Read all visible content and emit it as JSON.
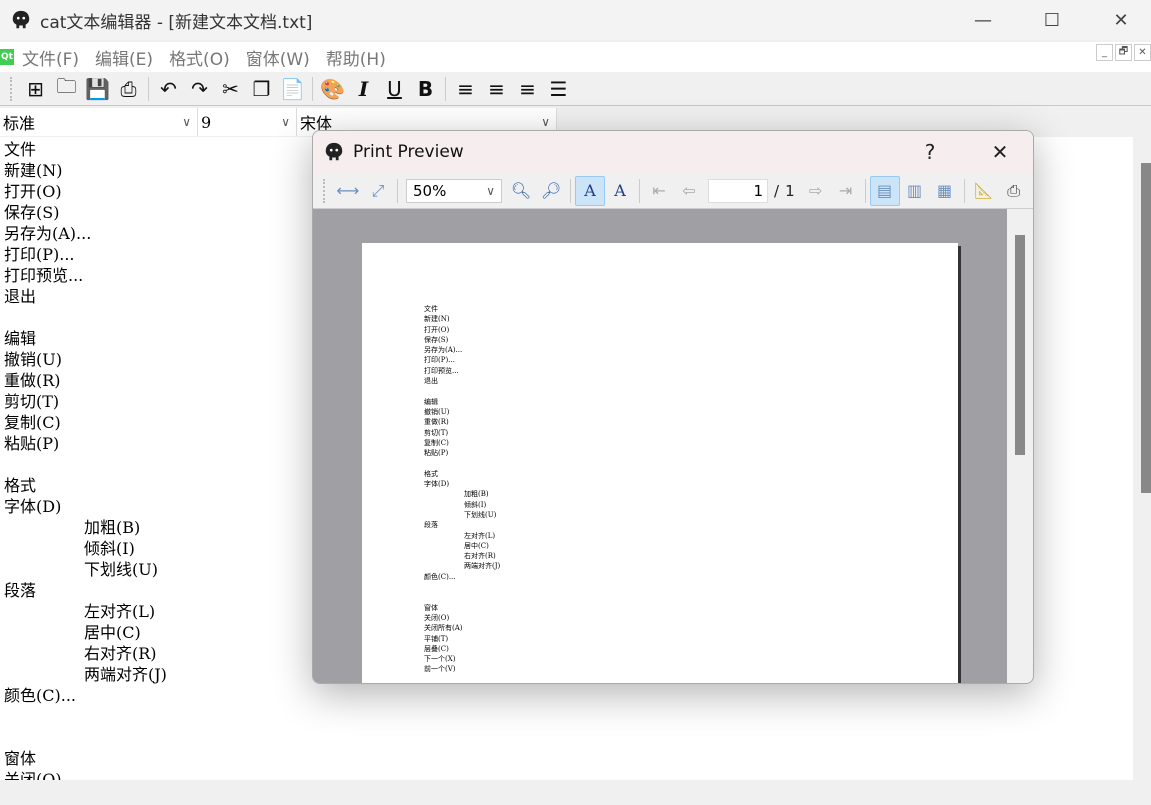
{
  "window": {
    "title": "cat文本编辑器 - [新建文本文档.txt]",
    "minimize": "—",
    "maximize": "☐",
    "close": "✕"
  },
  "menubar": {
    "logo": "Qt",
    "items": [
      "文件(F)",
      "编辑(E)",
      "格式(O)",
      "窗体(W)",
      "帮助(H)"
    ],
    "mdi": [
      "_",
      "🗗",
      "✕"
    ]
  },
  "toolbar": {
    "icons": [
      "new-file-icon",
      "open-folder-icon",
      "save-icon",
      "print-icon",
      "undo-icon",
      "redo-icon",
      "cut-icon",
      "copy-icon",
      "paste-icon",
      "color-palette-icon",
      "italic-icon",
      "underline-icon",
      "bold-icon",
      "align-left-icon",
      "align-center-icon",
      "align-right-icon",
      "justify-icon"
    ],
    "glyphs": [
      "⊞",
      "🗀",
      "💾",
      "⎙",
      "↶",
      "↷",
      "✂",
      "❐",
      "📄",
      "🎨",
      "I",
      "U",
      "B",
      "≡",
      "≡",
      "≡",
      "☰"
    ]
  },
  "combos": {
    "style": "标准",
    "size": "9",
    "font": "宋体"
  },
  "document": {
    "lines": [
      "文件",
      "新建(N)",
      "打开(O)",
      "保存(S)",
      "另存为(A)...",
      "打印(P)...",
      "打印预览...",
      "退出",
      "",
      "编辑",
      "撤销(U)",
      "重做(R)",
      "剪切(T)",
      "复制(C)",
      "粘贴(P)",
      "",
      "格式",
      "字体(D)",
      "\t加粗(B)",
      "\t倾斜(I)",
      "\t下划线(U)",
      "段落",
      "\t左对齐(L)",
      "\t居中(C)",
      "\t右对齐(R)",
      "\t两端对齐(J)",
      "颜色(C)...",
      "",
      "",
      "窗体",
      "关闭(O)",
      "关闭所有(A)",
      "平铺(T)",
      "层叠(C)",
      "下一个(X)",
      "前一个(V)"
    ]
  },
  "preview": {
    "title": "Print Preview",
    "help": "?",
    "close": "✕",
    "zoom": "50%",
    "page": "1",
    "separator": "/",
    "page_total": "1",
    "tools": [
      "fit-width",
      "fit-page",
      "zoom-out",
      "zoom-in",
      "portrait",
      "landscape",
      "first-page",
      "prev-page",
      "next-page",
      "last-page",
      "single-page",
      "facing-pages",
      "all-pages",
      "page-setup",
      "print"
    ]
  }
}
